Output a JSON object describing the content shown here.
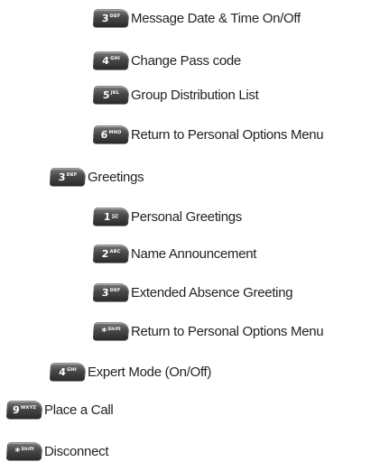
{
  "items": [
    {
      "key_digit": "3",
      "key_letters": "DEF",
      "label": "Message Date & Time On/Off"
    },
    {
      "key_digit": "4",
      "key_letters": "GHI",
      "label": "Change Pass code"
    },
    {
      "key_digit": "5",
      "key_letters": "JKL",
      "label": "Group Distribution List"
    },
    {
      "key_digit": "6",
      "key_letters": "MNO",
      "label": "Return to Personal Options Menu"
    },
    {
      "key_digit": "3",
      "key_letters": "DEF",
      "label": "Greetings"
    },
    {
      "key_digit": "1",
      "key_glyph": "✉",
      "label": "Personal Greetings"
    },
    {
      "key_digit": "2",
      "key_letters": "ABC",
      "label": "Name Announcement"
    },
    {
      "key_digit": "3",
      "key_letters": "DEF",
      "label": "Extended Absence Greeting"
    },
    {
      "key_digit": "*",
      "key_letters": "Shift",
      "label": "Return to Personal Options Menu"
    },
    {
      "key_digit": "4",
      "key_letters": "GHI",
      "label": "Expert Mode (On/Off)"
    },
    {
      "key_digit": "9",
      "key_letters": "WXYZ",
      "label": "Place a Call"
    },
    {
      "key_digit": "*",
      "key_letters": "Shift",
      "label": "Disconnect"
    }
  ]
}
